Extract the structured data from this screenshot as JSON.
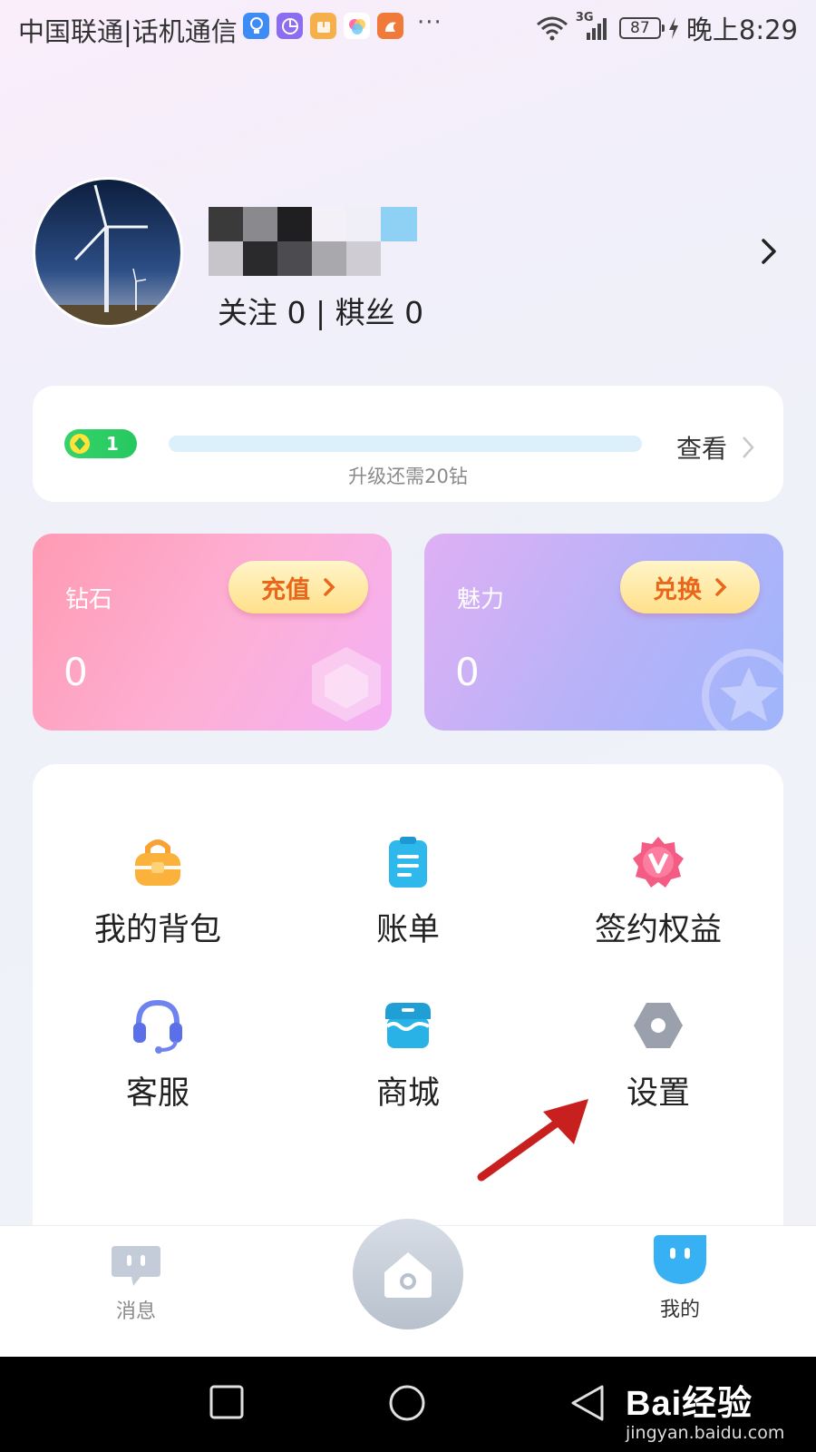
{
  "status_bar": {
    "carrier": "中国联通|话机通信",
    "more": "···",
    "network": "3G",
    "battery": "87",
    "time": "晚上8:29"
  },
  "profile": {
    "follow_stats": "关注 0 | 粸丝 0"
  },
  "level": {
    "badge_level": "1",
    "hint": "升级还需20钻",
    "view_label": "查看",
    "progress": 0
  },
  "wallet": {
    "diamond": {
      "label": "钻石",
      "value": "0",
      "button": "充值"
    },
    "charm": {
      "label": "魅力",
      "value": "0",
      "button": "兑换"
    }
  },
  "menu": {
    "items": [
      {
        "label": "我的背包",
        "icon": "backpack-icon"
      },
      {
        "label": "账单",
        "icon": "bill-icon"
      },
      {
        "label": "签约权益",
        "icon": "vip-badge-icon"
      },
      {
        "label": "客服",
        "icon": "headset-icon"
      },
      {
        "label": "商城",
        "icon": "shop-icon"
      },
      {
        "label": "设置",
        "icon": "settings-icon"
      }
    ]
  },
  "bottom_nav": {
    "messages": "消息",
    "mine": "我的"
  },
  "watermark": {
    "brand": "Bai经验",
    "url": "jingyan.baidu.com"
  },
  "colors": {
    "accent_orange": "#e9661a",
    "level_green": "#25c85f",
    "arrow_red": "#c8201f"
  }
}
